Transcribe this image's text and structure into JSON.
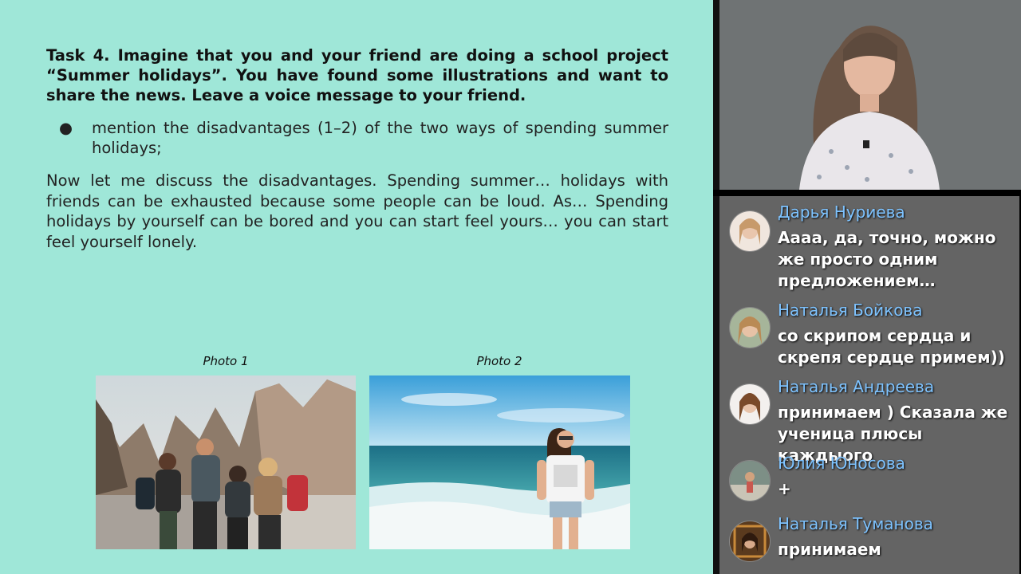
{
  "slide": {
    "task": "Task 4. Imagine that you and your friend are doing a school project “Summer holidays”. You have found some illustrations and want to share the news. Leave a voice message to your friend.",
    "bullet_symbol": "●",
    "bullet": "mention the disadvantages (1–2) of the two ways of spending summer holidays;",
    "answer": "Now let me discuss the disadvantages. Spending summer… holidays with friends can be exhausted because some people can be loud. As… Spending holidays by yourself can be bored and you can start feel yours… you can start feel yourself lonely.",
    "photo1_caption": "Photo 1",
    "photo2_caption": "Photo 2"
  },
  "chat": {
    "messages": [
      {
        "author": "Дарья Нуриева",
        "text": "Аааа, да, точно, можно же просто одним предложением…"
      },
      {
        "author": "Наталья Бойкова",
        "text": "со скрипом сердца и скрепя сердце примем))"
      },
      {
        "author": "Наталья Андреева",
        "text": "принимаем ) Сказала же ученица плюсы каждыого"
      },
      {
        "author": "Юлия Юносова",
        "text": "+"
      },
      {
        "author": "Наталья Туманова",
        "text": "принимаем"
      }
    ]
  },
  "colors": {
    "slide_bg": "#9fe7d8",
    "chat_bg": "#646464",
    "author_name": "#7ec3ff"
  }
}
